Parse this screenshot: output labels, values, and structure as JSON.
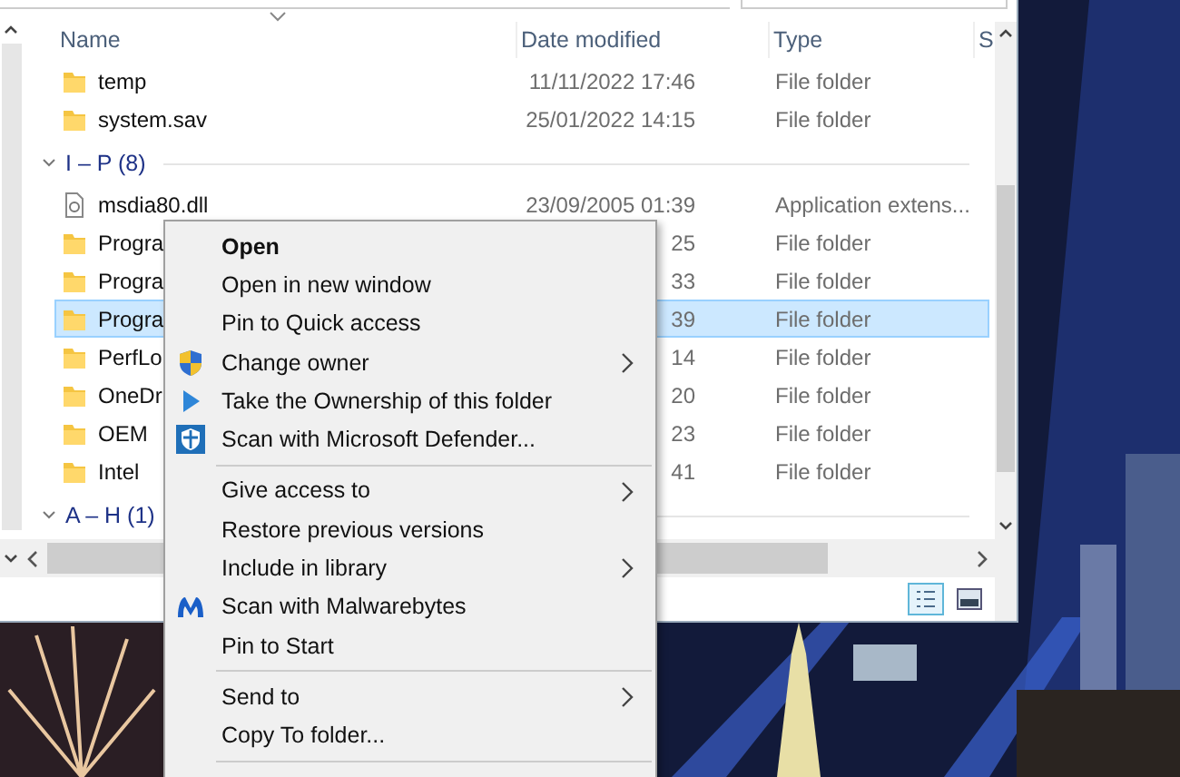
{
  "explorer": {
    "columns": [
      "Name",
      "Date modified",
      "Type",
      "S"
    ],
    "groups": [
      {
        "rows": [
          {
            "name": "temp",
            "date": "11/11/2022 17:46",
            "type": "File folder",
            "kind": "folder",
            "selected": false
          },
          {
            "name": "system.sav",
            "date": "25/01/2022 14:15",
            "type": "File folder",
            "kind": "folder",
            "selected": false
          }
        ]
      },
      {
        "label": "I – P (8)",
        "expanded": true,
        "rows": [
          {
            "name": "msdia80.dll",
            "date": "23/09/2005 01:39",
            "type": "Application extens...",
            "kind": "file",
            "selected": false
          },
          {
            "name": "Progra",
            "date": "25",
            "type": "File folder",
            "kind": "folder",
            "selected": false
          },
          {
            "name": "Progra",
            "date": "33",
            "type": "File folder",
            "kind": "folder",
            "selected": false
          },
          {
            "name": "Progra",
            "date": "39",
            "type": "File folder",
            "kind": "folder",
            "selected": true
          },
          {
            "name": "PerfLo",
            "date": "14",
            "type": "File folder",
            "kind": "folder",
            "selected": false
          },
          {
            "name": "OneDr",
            "date": "20",
            "type": "File folder",
            "kind": "folder",
            "selected": false
          },
          {
            "name": "OEM",
            "date": "23",
            "type": "File folder",
            "kind": "folder",
            "selected": false
          },
          {
            "name": "Intel",
            "date": "41",
            "type": "File folder",
            "kind": "folder",
            "selected": false
          }
        ]
      },
      {
        "label": "A – H (1)",
        "expanded": true
      }
    ],
    "view_buttons": [
      {
        "kind": "details",
        "selected": true
      },
      {
        "kind": "thumbnails",
        "selected": false
      }
    ]
  },
  "context_menu": {
    "items": [
      {
        "kind": "item",
        "label": "Open",
        "default": true,
        "submenu": false
      },
      {
        "kind": "item",
        "label": "Open in new window",
        "default": false,
        "submenu": false
      },
      {
        "kind": "item",
        "label": "Pin to Quick access",
        "default": false,
        "submenu": false
      },
      {
        "kind": "shield",
        "label": "Change owner",
        "default": false,
        "submenu": true
      },
      {
        "kind": "play",
        "label": "Take the Ownership of this folder",
        "default": false,
        "submenu": false
      },
      {
        "kind": "defender",
        "label": "Scan with Microsoft Defender...",
        "default": false,
        "submenu": false
      },
      {
        "kind": "separator"
      },
      {
        "kind": "item",
        "label": "Give access to",
        "default": false,
        "submenu": true
      },
      {
        "kind": "item",
        "label": "Restore previous versions",
        "default": false,
        "submenu": false
      },
      {
        "kind": "item",
        "label": "Include in library",
        "default": false,
        "submenu": true
      },
      {
        "kind": "malwarebytes",
        "label": "Scan with Malwarebytes",
        "default": false,
        "submenu": false
      },
      {
        "kind": "item",
        "label": "Pin to Start",
        "default": false,
        "submenu": false
      },
      {
        "kind": "separator"
      },
      {
        "kind": "item",
        "label": "Send to",
        "default": false,
        "submenu": true
      },
      {
        "kind": "item",
        "label": "Copy To folder...",
        "default": false,
        "submenu": false
      },
      {
        "kind": "separator"
      }
    ]
  }
}
